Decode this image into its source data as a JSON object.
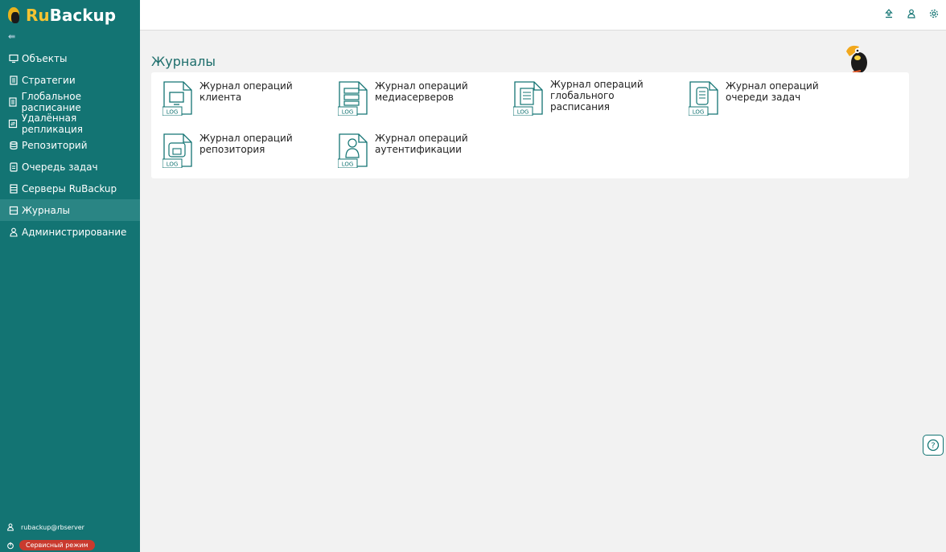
{
  "brand": {
    "part1": "Ru",
    "part2": "Backup"
  },
  "sidebar": {
    "collapse_glyph": "⇚",
    "items": [
      {
        "label": "Объекты",
        "icon": "monitor-icon"
      },
      {
        "label": "Стратегии",
        "icon": "strategy-icon"
      },
      {
        "label": "Глобальное расписание",
        "icon": "schedule-icon"
      },
      {
        "label": "Удалённая репликация",
        "icon": "replication-icon"
      },
      {
        "label": "Репозиторий",
        "icon": "database-icon"
      },
      {
        "label": "Очередь задач",
        "icon": "queue-icon"
      },
      {
        "label": "Серверы RuBackup",
        "icon": "server-icon"
      },
      {
        "label": "Журналы",
        "icon": "log-icon",
        "active": true
      },
      {
        "label": "Администрирование",
        "icon": "user-icon"
      }
    ],
    "user": "rubackup@rbserver",
    "mode_label": "Сервисный режим"
  },
  "page": {
    "title": "Журналы"
  },
  "tiles": [
    {
      "line1": "Журнал операций",
      "line2": "клиента",
      "line3": "",
      "badge": "LOG",
      "icon": "client-log-icon"
    },
    {
      "line1": "Журнал операций",
      "line2": "медиасерверов",
      "line3": "",
      "badge": "LOG",
      "icon": "mediaserver-log-icon"
    },
    {
      "line1": "Журнал операций",
      "line2": "глобального",
      "line3": "расписания",
      "badge": "LOG",
      "icon": "schedule-log-icon"
    },
    {
      "line1": "Журнал операций",
      "line2": "очереди задач",
      "line3": "",
      "badge": "LOG",
      "icon": "queue-log-icon"
    },
    {
      "line1": "Журнал операций",
      "line2": "репозитория",
      "line3": "",
      "badge": "LOG",
      "icon": "repository-log-icon"
    },
    {
      "line1": "Журнал операций",
      "line2": "аутентификации",
      "line3": "",
      "badge": "LOG",
      "icon": "auth-log-icon"
    }
  ],
  "help": {
    "glyph": "?"
  },
  "colors": {
    "sidebar": "#137473",
    "accent": "#1c6d6b",
    "badge": "#c93a2e"
  }
}
